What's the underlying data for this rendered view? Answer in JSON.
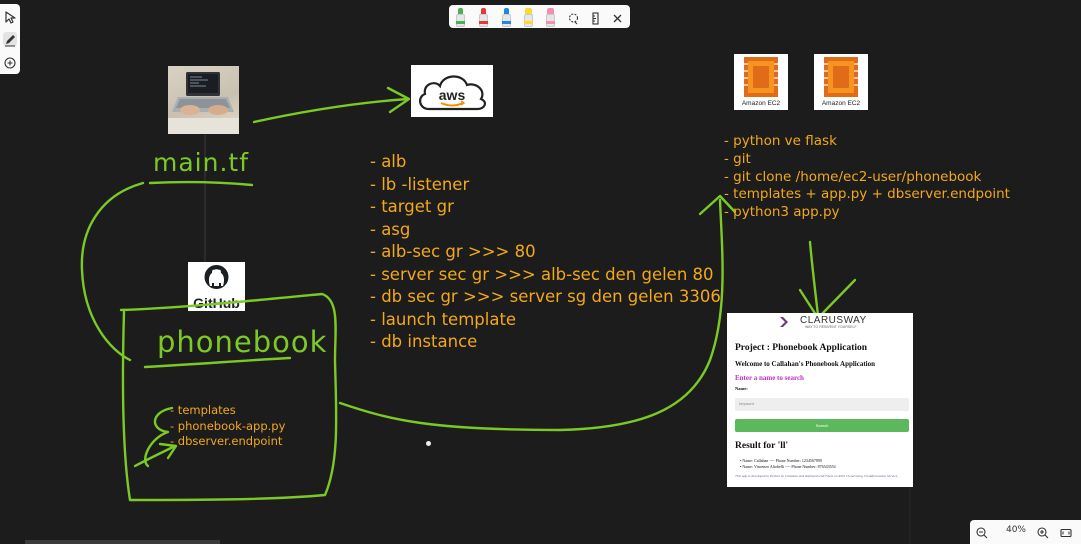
{
  "toolbar": {
    "left": [
      "select-tool",
      "pen-tool",
      "add-tool"
    ],
    "pens": [
      {
        "name": "green-pen",
        "color": "#4caf50"
      },
      {
        "name": "red-pen",
        "color": "#e53935"
      },
      {
        "name": "blue-pen",
        "color": "#1e88e5"
      },
      {
        "name": "yellow-highlighter",
        "color": "#fdd835"
      },
      {
        "name": "pink-highlighter",
        "color": "#f48fb1"
      }
    ],
    "icons": [
      "lasso-icon",
      "ruler-icon",
      "close-icon"
    ]
  },
  "canvas": {
    "background": "#1c1c1c",
    "ink_green": "#7cc925",
    "ink_orange": "#f2a81b",
    "main_tf_label": "main.tf",
    "phonebook_label": "phonebook",
    "aws_logo_text": "aws",
    "github_logo_text": "GitHub",
    "ec2_labels": [
      "Amazon EC2",
      "Amazon EC2"
    ],
    "aws_list": [
      "- alb",
      "- lb -listener",
      "- target gr",
      "- asg",
      "- alb-sec gr >>> 80",
      "- server sec gr >>> alb-sec den gelen 80",
      "- db sec gr >>> server sg den gelen 3306",
      "- launch template",
      "- db instance"
    ],
    "ec2_list": [
      "- python ve flask",
      "- git",
      "- git clone /home/ec2-user/phonebook",
      "- templates + app.py + dbserver.endpoint",
      "- python3 app.py"
    ],
    "phonebook_list": [
      "- templates",
      "- phonebook-app.py",
      "- dbserver.endpoint"
    ]
  },
  "app_screenshot": {
    "brand": "CLARUSWAY",
    "tagline": "WAY TO REINVENT YOURSELF",
    "title": "Project : Phonebook Application",
    "welcome": "Welcome to Callahan's Phonebook Application",
    "prompt": "Enter a name to search",
    "name_label": "Name:",
    "input_placeholder": "keyword",
    "button_label": "Search",
    "result_title": "Result for 'll'",
    "results": [
      "Name: Callahan ---- Phone Number: 1234567890",
      "Name: Vincenzo Altobelli ---- Phone Number: 876543554"
    ],
    "footer": "This app is developed in Python by Callahan and deployed with Flask on AWS Cloud using Cloudformation Service.",
    "button_color": "#5cb85c",
    "prompt_color": "#c030c0"
  },
  "zoom": {
    "level": "40%"
  }
}
